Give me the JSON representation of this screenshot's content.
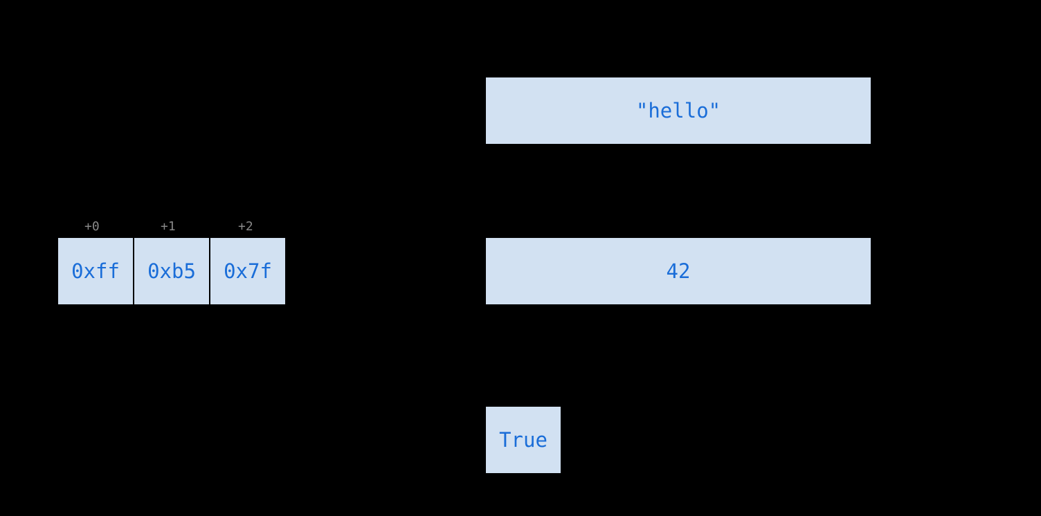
{
  "bytes": {
    "offsets": [
      "+0",
      "+1",
      "+2"
    ],
    "values": [
      "0xff",
      "0xb5",
      "0x7f"
    ]
  },
  "objects": {
    "string_value": "\"hello\"",
    "int_value": "42",
    "bool_value": "True"
  }
}
